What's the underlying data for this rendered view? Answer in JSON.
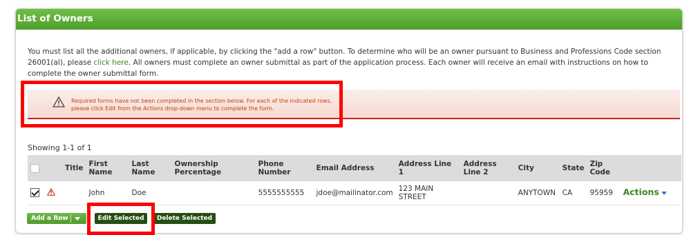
{
  "panel": {
    "title": "List of Owners"
  },
  "intro": {
    "part1": "You must list all the additional owners, if applicable, by clicking the \"add a row\" button. To determine who will be an owner pursuant to Business and Professions Code section 26001(al), please ",
    "link": "click here",
    "part2": ". All owners must complete an owner submittal as part of the application process. Each owner will receive an email with instructions on how to complete the owner submittal form."
  },
  "alert": {
    "line1": "Required forms have not been completed in the section below. For each of the indicated rows,",
    "line2": "please click Edit from the Actions drop-down menu to complete the form.",
    "icon": "warning-icon",
    "color": "#c2410c"
  },
  "table": {
    "showing": "Showing 1-1 of 1",
    "headers": {
      "title": "Title",
      "first_name": "First Name",
      "last_name": "Last Name",
      "ownership": "Ownership Percentage",
      "phone": "Phone Number",
      "email": "Email Address",
      "address1": "Address Line 1",
      "address2": "Address Line 2",
      "city": "City",
      "state": "State",
      "zip": "Zip Code"
    },
    "rows": [
      {
        "checked": true,
        "title": "",
        "first_name": "John",
        "last_name": "Doe",
        "ownership": "",
        "phone": "5555555555",
        "email": "jdoe@mailinator.com",
        "address1": "123 MAIN STREET",
        "address2": "",
        "city": "ANYTOWN",
        "state": "CA",
        "zip": "95959",
        "actions": "Actions"
      }
    ]
  },
  "buttons": {
    "add_row": "Add a Row",
    "edit_selected": "Edit Selected",
    "delete_selected": "Delete Selected"
  },
  "colors": {
    "header_green": "#5aa836",
    "link_green": "#3a8a1c",
    "alert_border": "#c0281c",
    "highlight_frame": "#ff0000"
  }
}
